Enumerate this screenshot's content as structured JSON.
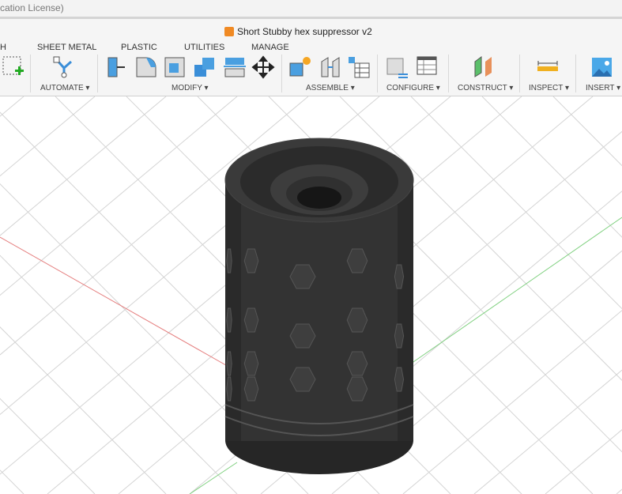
{
  "window": {
    "title_fragment": "cation License)"
  },
  "document": {
    "title": "Short Stubby hex suppressor v2"
  },
  "tabs": [
    "H",
    "SHEET METAL",
    "PLASTIC",
    "UTILITIES",
    "MANAGE"
  ],
  "groups": {
    "automate": "AUTOMATE ▾",
    "modify": "MODIFY ▾",
    "assemble": "ASSEMBLE ▾",
    "configure": "CONFIGURE ▾",
    "construct": "CONSTRUCT ▾",
    "inspect": "INSPECT ▾",
    "insert": "INSERT ▾"
  },
  "colors": {
    "accent": "#4a9fe0",
    "body": "#2f2f2f",
    "x_axis": "#e06060",
    "y_axis": "#60c060"
  }
}
